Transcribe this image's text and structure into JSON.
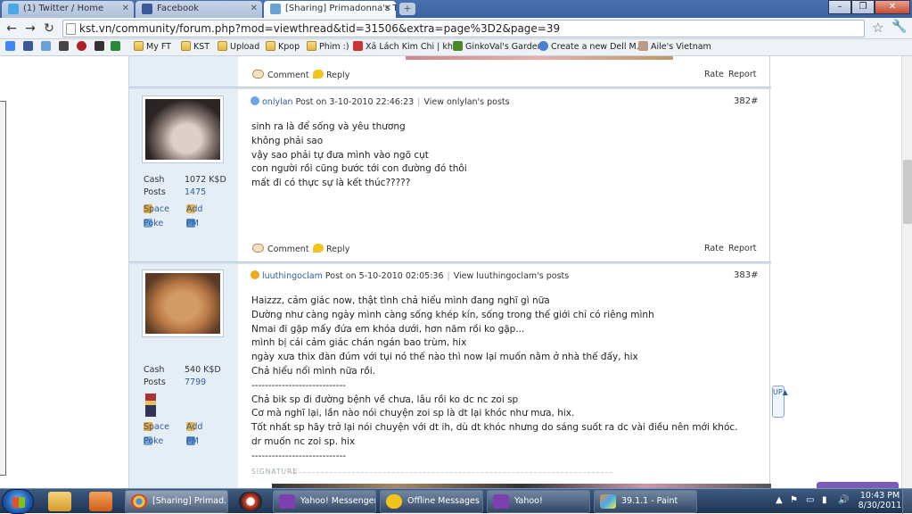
{
  "browser": {
    "tabs": [
      {
        "title": "(1) Twitter / Home"
      },
      {
        "title": "Facebook"
      },
      {
        "title": "[Sharing] Primadonna's Tư..."
      }
    ],
    "url": "kst.vn/community/forum.php?mod=viewthread&tid=31506&extra=page%3D2&page=39",
    "bookmarks": [
      "My FT",
      "KST",
      "Upload",
      "Kpop",
      "Phim :)",
      "Xả Lách Kim Chi | kh...",
      "GinkoVal's Garden",
      "Create a new Dell M...",
      "Aile's Vietnam"
    ]
  },
  "labels": {
    "comment": "Comment",
    "reply": "Reply",
    "rate": "Rate",
    "report": "Report",
    "cash": "Cash",
    "posts": "Posts",
    "space": "Space",
    "add": "Add",
    "poke": "Poke",
    "pm": "PM",
    "signature": "SIGNATURE",
    "up": "UP▲"
  },
  "posts": [
    {
      "author": "onlylan",
      "posted": "Post on 3-10-2010 22:46:23",
      "view_posts": "View onlylan's posts",
      "number": "382#",
      "cash": "1072 K$D",
      "post_count": "1475",
      "lines": [
        "sinh ra là để sống và yêu thương",
        "không phải sao",
        "vậy sao phải tự đưa mình vào ngõ cụt",
        "con người rồi cũng bước tới con đường đó thôi",
        "mất đi có thực sự là kết thúc?????"
      ]
    },
    {
      "author": "luuthingoclam",
      "posted": "Post on 5-10-2010 02:05:36",
      "view_posts": "View luuthingoclam's posts",
      "number": "383#",
      "cash": "540 K$D",
      "post_count": "7799",
      "lines": [
        "Haizzz, cảm giác now, thật tình chả hiểu mình đang nghĩ gì nữa",
        "Dường như càng ngày mình càng sống khép kín, sống trong thế giới chỉ có riêng mình",
        "Nmai đi gặp mấy đứa em khóa dưới, hơn năm rồi ko gặp...",
        "mình bị cái cảm giác chán ngán bao trùm, hix",
        "ngày xưa thix đàn đúm với tụi nó thế nào thì now lại muốn nằm ở nhà thế đấy, hix",
        "Chả hiểu nổi mình nữa rồi.",
        "----------------------------",
        "Chả bik sp đi đường bệnh về chưa, lâu rồi ko dc nc zoi sp",
        "Cơ mà nghĩ lại, lần nào nói chuyện zoi sp là dt lại khóc như mưa, hix.",
        "Tốt nhất sp hãy trở lại nói chuyện với dt ih, dù dt khóc nhưng do sáng suốt ra dc vài điều nên mới khóc.",
        "dr muốn nc zoi sp. hix",
        "----------------------------"
      ]
    }
  ],
  "taskbar": {
    "items": [
      "[Sharing] Primad...",
      "Yahoo! Messenger",
      "Offline Messages",
      "Yahoo!",
      "39.1.1 - Paint"
    ],
    "time": "10:43 PM",
    "date": "8/30/2011"
  }
}
